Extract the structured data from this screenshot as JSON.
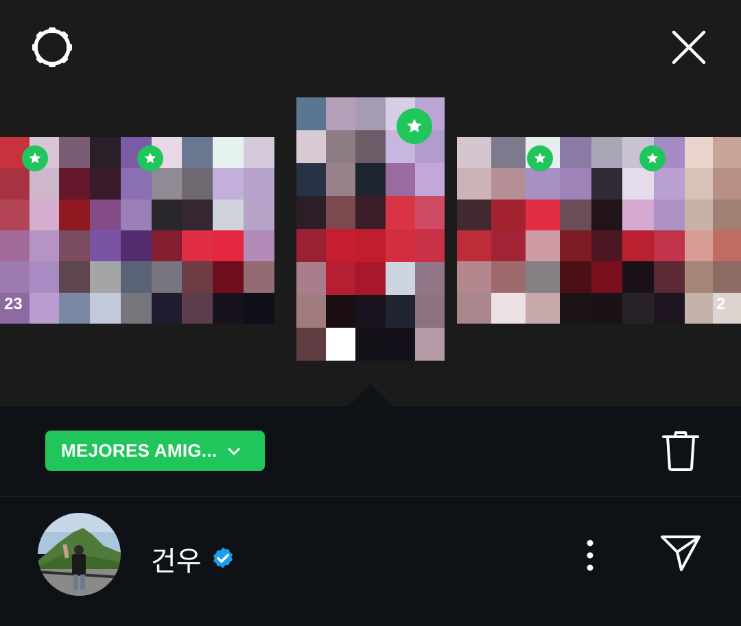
{
  "header": {
    "settings_icon": "gear-icon",
    "close_icon": "close-icon"
  },
  "stories": [
    {
      "id": "left-far",
      "views": "23",
      "best_friends": true
    },
    {
      "id": "left-near",
      "views": "",
      "best_friends": true
    },
    {
      "id": "center",
      "views": "",
      "best_friends": true,
      "selected": true
    },
    {
      "id": "right-near",
      "views": "",
      "best_friends": true
    },
    {
      "id": "right-mid",
      "views": "",
      "best_friends": true
    },
    {
      "id": "right-far",
      "views": "2",
      "best_friends": false
    }
  ],
  "audience": {
    "label": "MEJORES AMIG...",
    "color": "#20c55c",
    "icon": "chevron-down-icon"
  },
  "actions": {
    "delete_icon": "trash-icon",
    "more_icon": "more-vertical-icon",
    "send_icon": "send-icon"
  },
  "user": {
    "name": "건우",
    "verified": true,
    "verified_color": "#1d9bf0"
  },
  "colors": {
    "background_top": "#1b1b1b",
    "background_bottom": "#0e1216",
    "accent_green": "#20c55c"
  }
}
